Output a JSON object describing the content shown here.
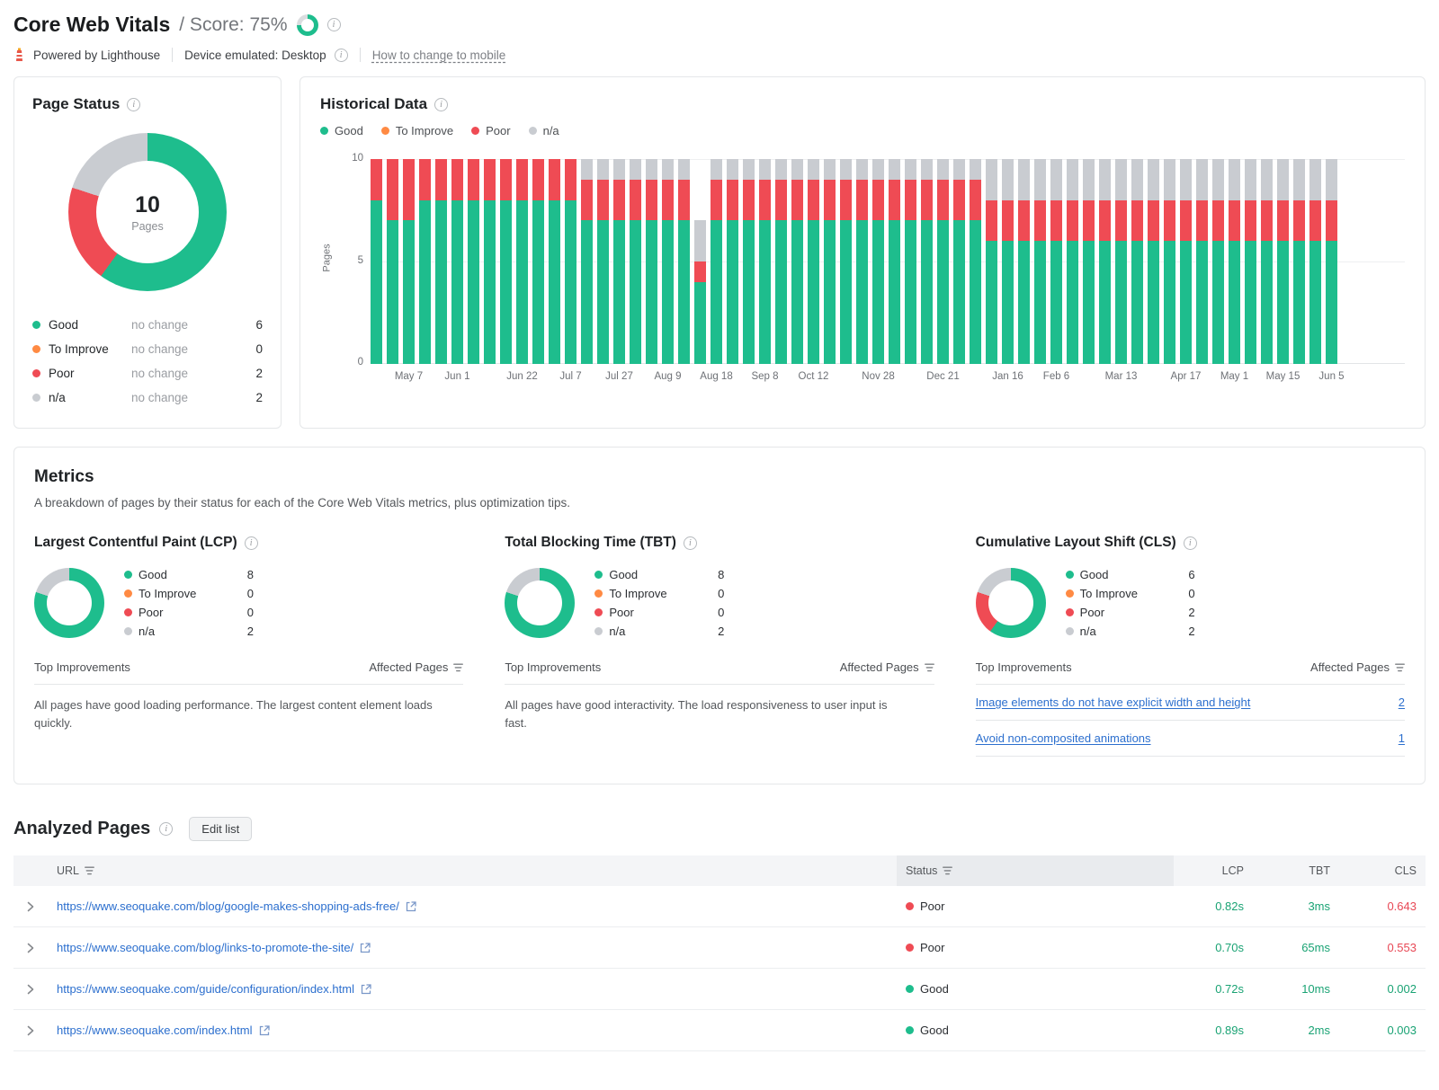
{
  "header": {
    "title": "Core Web Vitals",
    "score_label": "/ Score: 75%",
    "score_pct": 75,
    "powered_by": "Powered by Lighthouse",
    "device": "Device emulated: Desktop",
    "change_link": "How to change to mobile"
  },
  "colors": {
    "good": "#1ebd8d",
    "to_improve": "#ff8a43",
    "poor": "#ef4b54",
    "na": "#c9ccd1",
    "link": "#2c6fce",
    "text_good": "#1aa374",
    "text_poor": "#e84855"
  },
  "page_status": {
    "title": "Page Status",
    "total": "10",
    "total_label": "Pages",
    "legend": [
      {
        "label": "Good",
        "change": "no change",
        "value": 6,
        "color": "good"
      },
      {
        "label": "To Improve",
        "change": "no change",
        "value": 0,
        "color": "to_improve"
      },
      {
        "label": "Poor",
        "change": "no change",
        "value": 2,
        "color": "poor"
      },
      {
        "label": "n/a",
        "change": "no change",
        "value": 2,
        "color": "na"
      }
    ]
  },
  "historical": {
    "title": "Historical Data",
    "ylabel": "Pages",
    "yticks": [
      10,
      5,
      0
    ],
    "legend": [
      {
        "label": "Good",
        "color": "good"
      },
      {
        "label": "To Improve",
        "color": "to_improve"
      },
      {
        "label": "Poor",
        "color": "poor"
      },
      {
        "label": "n/a",
        "color": "na"
      }
    ]
  },
  "chart_data": [
    {
      "id": "page_status_donut",
      "type": "pie",
      "title": "Page Status",
      "labels": [
        "Good",
        "To Improve",
        "Poor",
        "n/a"
      ],
      "values": [
        6,
        0,
        2,
        2
      ],
      "center_text": "10 Pages"
    },
    {
      "id": "historical_stacked_bars",
      "type": "bar",
      "stacked": true,
      "title": "Historical Data",
      "xlabel": "",
      "ylabel": "Pages",
      "ylim": [
        0,
        10
      ],
      "series": [
        {
          "name": "Good",
          "values": [
            8,
            7,
            7,
            8,
            8,
            8,
            8,
            8,
            8,
            8,
            8,
            8,
            8,
            7,
            7,
            7,
            7,
            7,
            7,
            7,
            4,
            7,
            7,
            7,
            7,
            7,
            7,
            7,
            7,
            7,
            7,
            7,
            7,
            7,
            7,
            7,
            7,
            7,
            6,
            6,
            6,
            6,
            6,
            6,
            6,
            6,
            6,
            6,
            6,
            6,
            6,
            6,
            6,
            6,
            6,
            6,
            6,
            6,
            6,
            6
          ]
        },
        {
          "name": "To Improve",
          "values": [
            0,
            0,
            0,
            0,
            0,
            0,
            0,
            0,
            0,
            0,
            0,
            0,
            0,
            0,
            0,
            0,
            0,
            0,
            0,
            0,
            0,
            0,
            0,
            0,
            0,
            0,
            0,
            0,
            0,
            0,
            0,
            0,
            0,
            0,
            0,
            0,
            0,
            0,
            0,
            0,
            0,
            0,
            0,
            0,
            0,
            0,
            0,
            0,
            0,
            0,
            0,
            0,
            0,
            0,
            0,
            0,
            0,
            0,
            0,
            0
          ]
        },
        {
          "name": "Poor",
          "values": [
            2,
            3,
            3,
            2,
            2,
            2,
            2,
            2,
            2,
            2,
            2,
            2,
            2,
            2,
            2,
            2,
            2,
            2,
            2,
            2,
            1,
            2,
            2,
            2,
            2,
            2,
            2,
            2,
            2,
            2,
            2,
            2,
            2,
            2,
            2,
            2,
            2,
            2,
            2,
            2,
            2,
            2,
            2,
            2,
            2,
            2,
            2,
            2,
            2,
            2,
            2,
            2,
            2,
            2,
            2,
            2,
            2,
            2,
            2,
            2
          ]
        },
        {
          "name": "n/a",
          "values": [
            0,
            0,
            0,
            0,
            0,
            0,
            0,
            0,
            0,
            0,
            0,
            0,
            0,
            1,
            1,
            1,
            1,
            1,
            1,
            1,
            2,
            1,
            1,
            1,
            1,
            1,
            1,
            1,
            1,
            1,
            1,
            1,
            1,
            1,
            1,
            1,
            1,
            1,
            2,
            2,
            2,
            2,
            2,
            2,
            2,
            2,
            2,
            2,
            2,
            2,
            2,
            2,
            2,
            2,
            2,
            2,
            2,
            2,
            2,
            2
          ]
        }
      ],
      "x_tick_labels": [
        {
          "index": 2,
          "label": "May 7"
        },
        {
          "index": 5,
          "label": "Jun 1"
        },
        {
          "index": 9,
          "label": "Jun 22"
        },
        {
          "index": 12,
          "label": "Jul 7"
        },
        {
          "index": 15,
          "label": "Jul 27"
        },
        {
          "index": 18,
          "label": "Aug 9"
        },
        {
          "index": 21,
          "label": "Aug 18"
        },
        {
          "index": 24,
          "label": "Sep 8"
        },
        {
          "index": 27,
          "label": "Oct 12"
        },
        {
          "index": 31,
          "label": "Nov 28"
        },
        {
          "index": 35,
          "label": "Dec 21"
        },
        {
          "index": 39,
          "label": "Jan 16"
        },
        {
          "index": 42,
          "label": "Feb 6"
        },
        {
          "index": 46,
          "label": "Mar 13"
        },
        {
          "index": 50,
          "label": "Apr 17"
        },
        {
          "index": 53,
          "label": "May 1"
        },
        {
          "index": 56,
          "label": "May 15"
        },
        {
          "index": 59,
          "label": "Jun 5"
        }
      ],
      "legend_position": "top"
    },
    {
      "id": "lcp_donut",
      "type": "pie",
      "labels": [
        "Good",
        "To Improve",
        "Poor",
        "n/a"
      ],
      "values": [
        8,
        0,
        0,
        2
      ]
    },
    {
      "id": "tbt_donut",
      "type": "pie",
      "labels": [
        "Good",
        "To Improve",
        "Poor",
        "n/a"
      ],
      "values": [
        8,
        0,
        0,
        2
      ]
    },
    {
      "id": "cls_donut",
      "type": "pie",
      "labels": [
        "Good",
        "To Improve",
        "Poor",
        "n/a"
      ],
      "values": [
        6,
        0,
        2,
        2
      ]
    }
  ],
  "metrics": {
    "title": "Metrics",
    "subtitle": "A breakdown of pages by their status for each of the Core Web Vitals metrics, plus optimization tips.",
    "improvements_header": "Top Improvements",
    "affected_header": "Affected Pages",
    "cards": [
      {
        "title": "Largest Contentful Paint (LCP)",
        "legend": [
          {
            "label": "Good",
            "value": 8,
            "color": "good"
          },
          {
            "label": "To Improve",
            "value": 0,
            "color": "to_improve"
          },
          {
            "label": "Poor",
            "value": 0,
            "color": "poor"
          },
          {
            "label": "n/a",
            "value": 2,
            "color": "na"
          }
        ],
        "note": "All pages have good loading performance. The largest content element loads quickly."
      },
      {
        "title": "Total Blocking Time (TBT)",
        "legend": [
          {
            "label": "Good",
            "value": 8,
            "color": "good"
          },
          {
            "label": "To Improve",
            "value": 0,
            "color": "to_improve"
          },
          {
            "label": "Poor",
            "value": 0,
            "color": "poor"
          },
          {
            "label": "n/a",
            "value": 2,
            "color": "na"
          }
        ],
        "note": "All pages have good interactivity. The load responsiveness to user input is fast."
      },
      {
        "title": "Cumulative Layout Shift (CLS)",
        "legend": [
          {
            "label": "Good",
            "value": 6,
            "color": "good"
          },
          {
            "label": "To Improve",
            "value": 0,
            "color": "to_improve"
          },
          {
            "label": "Poor",
            "value": 2,
            "color": "poor"
          },
          {
            "label": "n/a",
            "value": 2,
            "color": "na"
          }
        ],
        "improvements": [
          {
            "text": "Image elements do not have explicit width and height",
            "count": "2"
          },
          {
            "text": "Avoid non-composited animations",
            "count": "1"
          }
        ]
      }
    ]
  },
  "analyzed": {
    "title": "Analyzed Pages",
    "edit_button": "Edit list",
    "columns": [
      "URL",
      "Status",
      "LCP",
      "TBT",
      "CLS"
    ],
    "rows": [
      {
        "url": "https://www.seoquake.com/blog/google-makes-shopping-ads-free/",
        "status": "Poor",
        "status_color": "poor",
        "lcp": "0.82s",
        "lcp_color": "good",
        "tbt": "3ms",
        "tbt_color": "good",
        "cls": "0.643",
        "cls_color": "poor"
      },
      {
        "url": "https://www.seoquake.com/blog/links-to-promote-the-site/",
        "status": "Poor",
        "status_color": "poor",
        "lcp": "0.70s",
        "lcp_color": "good",
        "tbt": "65ms",
        "tbt_color": "good",
        "cls": "0.553",
        "cls_color": "poor"
      },
      {
        "url": "https://www.seoquake.com/guide/configuration/index.html",
        "status": "Good",
        "status_color": "good",
        "lcp": "0.72s",
        "lcp_color": "good",
        "tbt": "10ms",
        "tbt_color": "good",
        "cls": "0.002",
        "cls_color": "good"
      },
      {
        "url": "https://www.seoquake.com/index.html",
        "status": "Good",
        "status_color": "good",
        "lcp": "0.89s",
        "lcp_color": "good",
        "tbt": "2ms",
        "tbt_color": "good",
        "cls": "0.003",
        "cls_color": "good"
      }
    ]
  }
}
